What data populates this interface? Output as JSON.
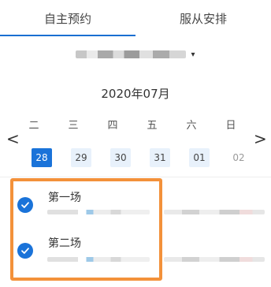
{
  "tabs": [
    {
      "label": "自主预约",
      "active": true
    },
    {
      "label": "服从安排",
      "active": false
    }
  ],
  "selector": {
    "value_obscured": true,
    "caret": "▾"
  },
  "calendar": {
    "month": "2020年07月",
    "weekdays": [
      "二",
      "三",
      "四",
      "五",
      "六",
      "日"
    ],
    "dates": [
      {
        "day": "28",
        "state": "selected"
      },
      {
        "day": "29",
        "state": "available"
      },
      {
        "day": "30",
        "state": "available"
      },
      {
        "day": "31",
        "state": "available"
      },
      {
        "day": "01",
        "state": "available"
      },
      {
        "day": "02",
        "state": "disabled"
      }
    ],
    "prev": "<",
    "next": ">"
  },
  "sessions": [
    {
      "name": "第一场",
      "checked": true
    },
    {
      "name": "第二场",
      "checked": true
    }
  ],
  "colors": {
    "accent": "#1a73d9",
    "highlight": "#f3913a",
    "date_bg": "#e8f1fb"
  }
}
